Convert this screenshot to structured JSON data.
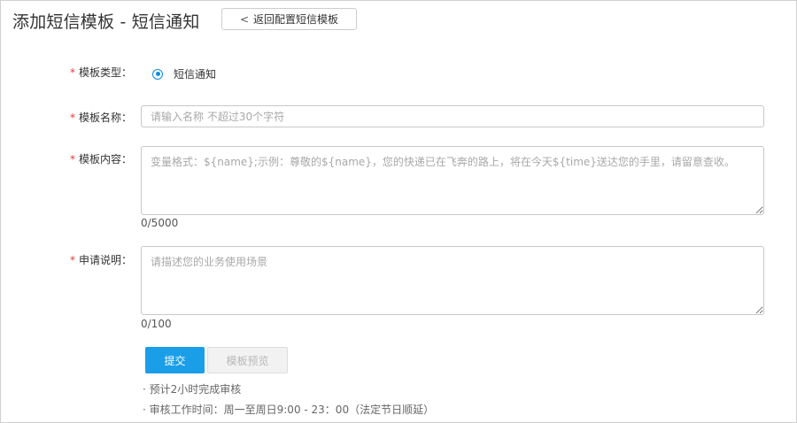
{
  "header": {
    "title": "添加短信模板 - 短信通知",
    "back_button_label": "返回配置短信模板",
    "back_icon": "chevron-left-icon"
  },
  "form": {
    "required_mark": "*",
    "template_type": {
      "label": "模板类型：",
      "selected_option": "短信通知"
    },
    "template_name": {
      "label": "模板名称：",
      "value": "",
      "placeholder": "请输入名称 不超过30个字符"
    },
    "template_content": {
      "label": "模板内容：",
      "value": "",
      "placeholder": "变量格式：${name};示例：尊敬的${name}，您的快递已在飞奔的路上，将在今天${time}送达您的手里，请留意查收。",
      "counter": "0/5000"
    },
    "application_note": {
      "label": "申请说明：",
      "value": "",
      "placeholder": "请描述您的业务使用场景",
      "counter": "0/100"
    },
    "submit_label": "提交",
    "preview_label": "模板预览"
  },
  "notes": [
    "· 预计2小时完成审核",
    "· 审核工作时间：周一至周日9:00 - 23：00（法定节日顺延）"
  ],
  "colors": {
    "accent": "#1b9ee8",
    "required": "#e4393c",
    "disabled_text": "#b8b8b8"
  }
}
